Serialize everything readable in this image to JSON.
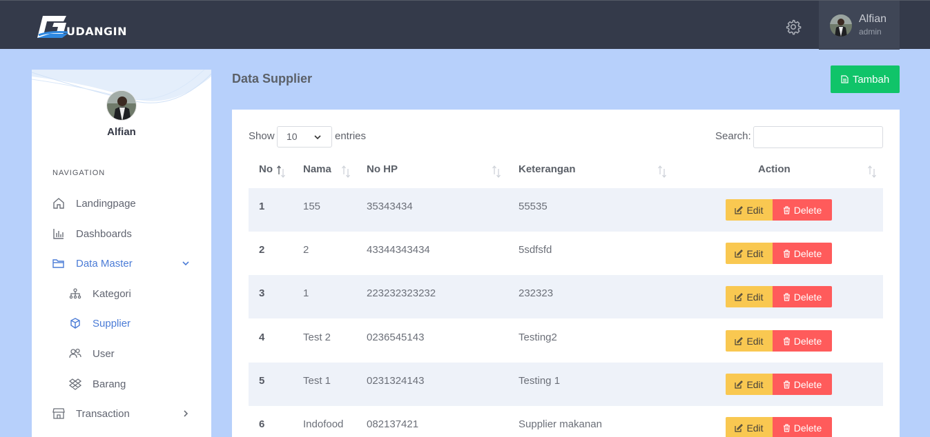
{
  "app": {
    "logo_text": "UDANGIN",
    "colors": {
      "topbar": "#343a4a",
      "background": "#b7d0fb",
      "accent": "#4a7bd6",
      "success": "#10c469",
      "warning": "#f9c851",
      "danger": "#ff5b5b"
    }
  },
  "header": {
    "user_name": "Alfian",
    "user_role": "admin",
    "settings_icon": "gear-icon"
  },
  "sidebar": {
    "profile_name": "Alfian",
    "nav_label": "NAVIGATION",
    "items": [
      {
        "label": "Landingpage",
        "icon": "home-icon"
      },
      {
        "label": "Dashboards",
        "icon": "bar-chart-icon"
      },
      {
        "label": "Data Master",
        "icon": "folder-icon",
        "expanded": true,
        "active": true
      },
      {
        "label": "Kategori",
        "icon": "sitemap-icon"
      },
      {
        "label": "Supplier",
        "icon": "cube-icon",
        "active": true
      },
      {
        "label": "User",
        "icon": "users-icon"
      },
      {
        "label": "Barang",
        "icon": "dropbox-icon"
      },
      {
        "label": "Transaction",
        "icon": "store-icon"
      }
    ]
  },
  "main": {
    "title": "Data Supplier",
    "add_button": "Tambah",
    "show_label": "Show",
    "page_size": "10",
    "entries_label": "entries",
    "search_label": "Search:",
    "search_value": "",
    "columns": [
      "No",
      "Nama",
      "No HP",
      "Keterangan",
      "Action"
    ],
    "edit_label": "Edit",
    "delete_label": "Delete",
    "rows": [
      {
        "no": "1",
        "nama": "155",
        "hp": "35343434",
        "ket": "55535"
      },
      {
        "no": "2",
        "nama": "2",
        "hp": "43344343434",
        "ket": "5sdfsfd"
      },
      {
        "no": "3",
        "nama": "1",
        "hp": "223232323232",
        "ket": "232323"
      },
      {
        "no": "4",
        "nama": "Test 2",
        "hp": "0236545143",
        "ket": "Testing2"
      },
      {
        "no": "5",
        "nama": "Test 1",
        "hp": "0231324143",
        "ket": "Testing 1"
      },
      {
        "no": "6",
        "nama": "Indofood",
        "hp": "082137421",
        "ket": "Supplier makanan"
      }
    ]
  }
}
